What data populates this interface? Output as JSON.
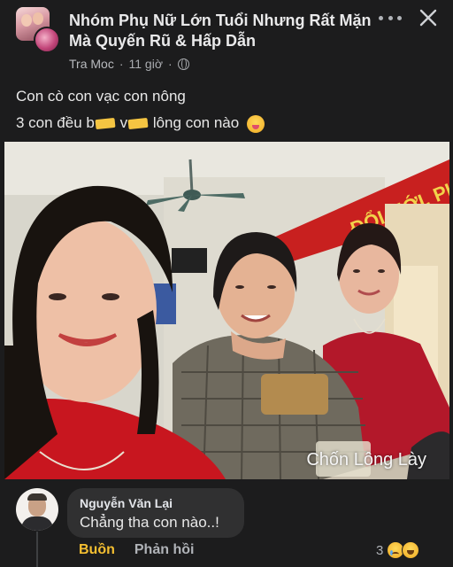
{
  "group": {
    "name": "Nhóm Phụ Nữ Lớn Tuổi Nhưng Rất Mặn Mà Quyến Rũ & Hấp Dẫn"
  },
  "post": {
    "author": "Tra Moc",
    "separator": "·",
    "time": "11 giờ",
    "line1": "Con cò con vạc con nông",
    "line2_start": "3 con đều b",
    "line2_mid": "v",
    "line2_end": "lông con nào",
    "photo_caption": "Chốn Lông Lày",
    "photo_banner_text": "ĐỔI MỚI, PHÁT TRI"
  },
  "comment": {
    "author": "Nguyễn Văn Lại",
    "text": "Chẳng tha con nào..!",
    "actions": {
      "sad": "Buồn",
      "reply": "Phản hồi"
    },
    "reaction_count": "3"
  },
  "colors": {
    "background": "#1c1c1d",
    "bubble": "#303031",
    "sad_reaction": "#f5bf31",
    "banner_red": "#c8201f",
    "banner_text": "#f2d24b"
  },
  "icons": {
    "more": "more-horizontal-icon",
    "close": "close-icon",
    "audience": "globe-icon",
    "emoji": "laughing-tongue-emoji-icon"
  }
}
